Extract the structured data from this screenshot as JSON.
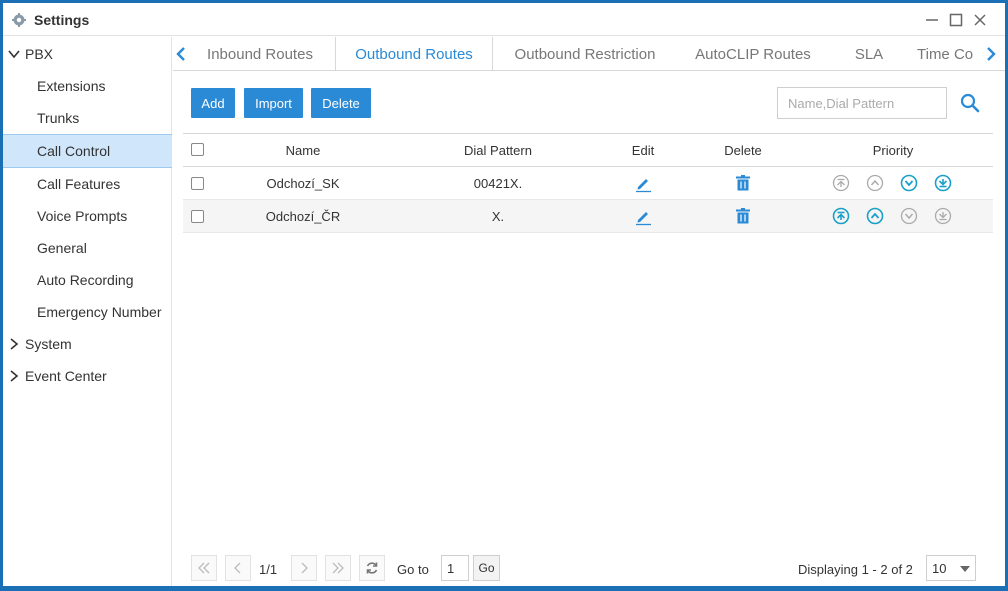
{
  "window": {
    "title": "Settings"
  },
  "sidebar": {
    "groups": [
      {
        "label": "PBX",
        "expanded": true
      },
      {
        "label": "System",
        "expanded": false
      },
      {
        "label": "Event Center",
        "expanded": false
      }
    ],
    "items": [
      {
        "label": "Extensions",
        "active": false
      },
      {
        "label": "Trunks",
        "active": false
      },
      {
        "label": "Call Control",
        "active": true
      },
      {
        "label": "Call Features",
        "active": false
      },
      {
        "label": "Voice Prompts",
        "active": false
      },
      {
        "label": "General",
        "active": false
      },
      {
        "label": "Auto Recording",
        "active": false
      },
      {
        "label": "Emergency Number",
        "active": false
      }
    ]
  },
  "tabs": [
    {
      "label": "Inbound Routes",
      "active": false
    },
    {
      "label": "Outbound Routes",
      "active": true
    },
    {
      "label": "Outbound Restriction",
      "active": false
    },
    {
      "label": "AutoCLIP Routes",
      "active": false
    },
    {
      "label": "SLA",
      "active": false
    },
    {
      "label": "Time Co",
      "active": false
    }
  ],
  "toolbar": {
    "add_label": "Add",
    "import_label": "Import",
    "delete_label": "Delete"
  },
  "search": {
    "placeholder": "Name,Dial Pattern",
    "value": ""
  },
  "table": {
    "headers": {
      "name": "Name",
      "dial_pattern": "Dial Pattern",
      "edit": "Edit",
      "delete": "Delete",
      "priority": "Priority"
    },
    "rows": [
      {
        "name": "Odchozí_SK",
        "dial_pattern": "00421X.",
        "priority": {
          "top": false,
          "up": false,
          "down": true,
          "bottom": true
        }
      },
      {
        "name": "Odchozí_ČR",
        "dial_pattern": "X.",
        "priority": {
          "top": true,
          "up": true,
          "down": false,
          "bottom": false
        }
      }
    ]
  },
  "pager": {
    "page_info": "1/1",
    "goto_label": "Go to",
    "goto_value": "1",
    "go_label": "Go",
    "displaying": "Displaying 1 - 2 of 2",
    "page_size": "10"
  },
  "colors": {
    "accent": "#2a8ad6",
    "active_nav": "#cfe6fb",
    "enabled_icon": "#1aa0c8",
    "disabled_icon": "#aaaaaa",
    "frame": "#1a6fb5"
  }
}
